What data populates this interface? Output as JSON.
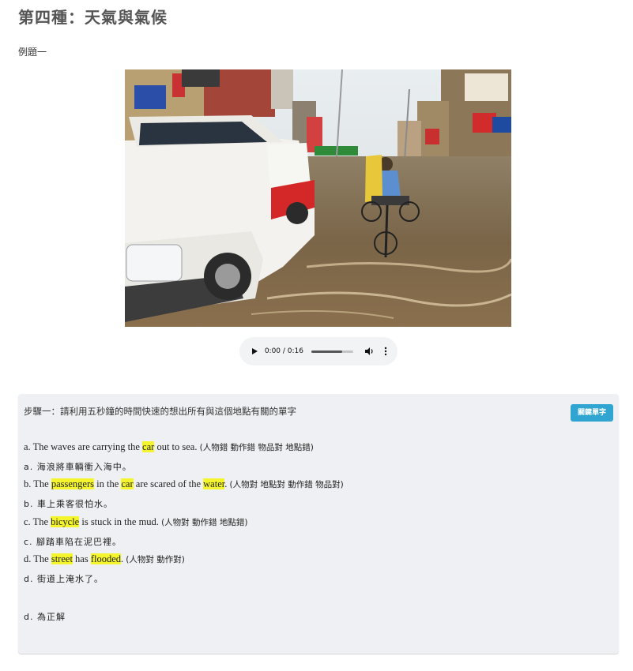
{
  "page_title": "第四種：天氣與氣候",
  "example_label": "例題一",
  "audio": {
    "time": "0:00 / 0:16",
    "progress": 0.74
  },
  "step": {
    "instruction": "步驟一：請利用五秒鐘的時間快速的想出所有與這個地點有關的單字",
    "vocab_button": "關鍵單字"
  },
  "options": {
    "a_en": {
      "t1": "a. The waves are carrying the ",
      "h1": "car",
      "t2": " out to sea. ",
      "tag": "(人物錯 動作錯 物品對 地點錯)"
    },
    "a_zh": "a. 海浪將車輛衝入海中。",
    "b_en": {
      "t1": "b. The ",
      "h1": "passengers",
      "t2": " in the ",
      "h2": "car",
      "t3": " are scared of the ",
      "h3": "water",
      "t4": ". ",
      "tag": "(人物對 地點對 動作錯 物品對)"
    },
    "b_zh": "b. 車上乘客很怕水。",
    "c_en": {
      "t1": "c. The ",
      "h1": "bicycle",
      "t2": " is stuck in the mud. ",
      "tag": "(人物對 動作錯 地點錯)"
    },
    "c_zh": "c. 腳踏車陷在泥巴裡。",
    "d_en": {
      "t1": "d. The ",
      "h1": "street",
      "t2": " has ",
      "h2": "flooded",
      "t3": ". ",
      "tag": "(人物對 動作對)"
    },
    "d_zh": "d. 街道上淹水了。"
  },
  "answer": "d. 為正解",
  "colors": {
    "button": "#31a5d1",
    "highlight": "#f4f52c",
    "panel": "#eef0f3"
  }
}
